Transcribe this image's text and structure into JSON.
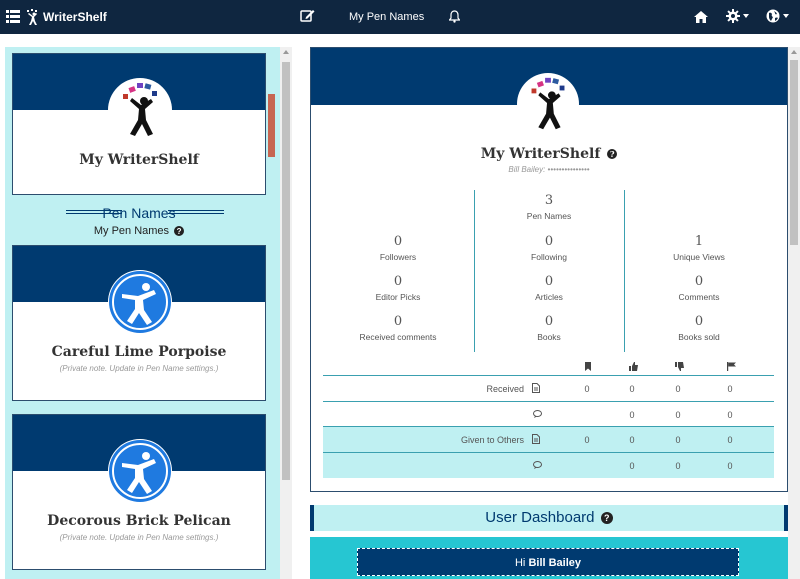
{
  "nav": {
    "menu_icon": "grid-menu-icon",
    "logo_text": "WriterShelf",
    "edit_icon": "edit-icon",
    "title": "My Pen Names",
    "bell_icon": "bell-icon",
    "home_icon": "home-icon",
    "settings_icon": "gear-icon",
    "language_icon": "globe-icon"
  },
  "sidebar": {
    "main_card": {
      "name": "My WriterShelf"
    },
    "heading": "Pen Names",
    "subheading": "My Pen Names",
    "help": "?",
    "pen_names": [
      {
        "name": "Careful Lime Porpoise",
        "note": "(Private note. Update in Pen Name settings.)"
      },
      {
        "name": "Decorous Brick Pelican",
        "note": "(Private note. Update in Pen Name settings.)"
      }
    ]
  },
  "profile": {
    "name": "My WriterShelf",
    "help": "?",
    "user_line": "Bill Bailey: •••••••••••••••",
    "stats": {
      "pen_names": {
        "value": "3",
        "label": "Pen Names"
      },
      "followers": {
        "value": "0",
        "label": "Followers"
      },
      "following": {
        "value": "0",
        "label": "Following"
      },
      "unique_views": {
        "value": "1",
        "label": "Unique Views"
      },
      "editor_picks": {
        "value": "0",
        "label": "Editor Picks"
      },
      "articles": {
        "value": "0",
        "label": "Articles"
      },
      "comments": {
        "value": "0",
        "label": "Comments"
      },
      "received_comments": {
        "value": "0",
        "label": "Received comments"
      },
      "books": {
        "value": "0",
        "label": "Books"
      },
      "books_sold": {
        "value": "0",
        "label": "Books sold"
      }
    },
    "table": {
      "header_icons": [
        "bookmark-icon",
        "thumbs-up-icon",
        "thumbs-down-icon",
        "flag-icon"
      ],
      "rows": [
        {
          "label": "Received",
          "icon": "document-icon",
          "values": [
            "0",
            "0",
            "0",
            "0"
          ]
        },
        {
          "label": "",
          "icon": "comment-icon",
          "values": [
            "",
            "0",
            "0",
            "0"
          ]
        },
        {
          "label": "Given to Others",
          "icon": "document-icon",
          "values": [
            "0",
            "0",
            "0",
            "0"
          ]
        },
        {
          "label": "",
          "icon": "comment-icon",
          "values": [
            "",
            "0",
            "0",
            "0"
          ]
        }
      ]
    }
  },
  "dashboard": {
    "title": "User Dashboard",
    "help": "?",
    "greeting": "Hi",
    "user": "Bill Bailey"
  },
  "colors": {
    "nav_bg": "#0f2640",
    "brand_blue": "#003a70",
    "light_cyan": "#bff0f2",
    "cyan": "#26c6d2",
    "scroll_accent": "#c66652"
  }
}
